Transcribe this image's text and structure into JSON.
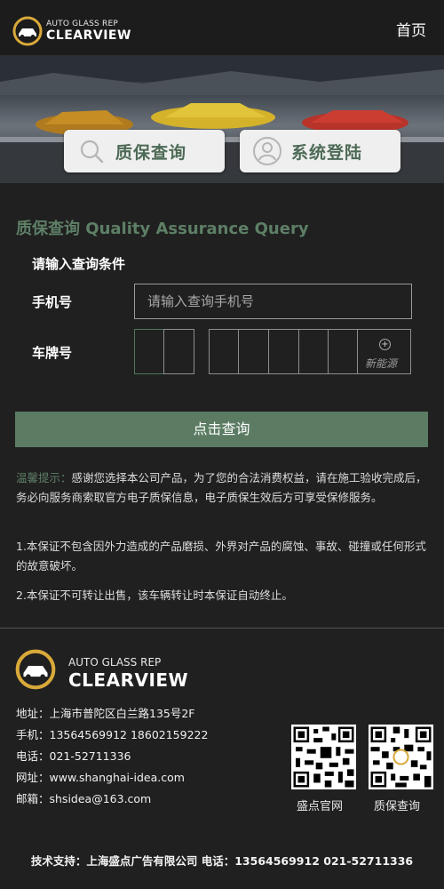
{
  "header": {
    "brand_small": "AUTO GLASS REP",
    "brand_big": "CLEARVIEW",
    "home_label": "首页"
  },
  "banner": {
    "query_label": "质保查询",
    "login_label": "系统登陆"
  },
  "form": {
    "section_title": "质保查询 Quality Assurance Query",
    "prompt": "请输入查询条件",
    "phone_label": "手机号",
    "phone_placeholder": "请输入查询手机号",
    "phone_value": "",
    "plate_label": "车牌号",
    "new_energy_label": "新能源",
    "submit_label": "点击查询"
  },
  "notice": {
    "tip_label": "温馨提示：",
    "tip_text": "感谢您选择本公司产品，为了您的合法消费权益，请在施工验收完成后，务必向服务商索取官方电子质保信息，电子质保生效后方可享受保修服务。",
    "item1": "1.本保证不包含因外力造成的产品磨损、外界对产品的腐蚀、事故、碰撞或任何形式的故意破坏。",
    "item2": "2.本保证不可转让出售，该车辆转让时本保证自动终止。"
  },
  "footer": {
    "brand_small": "AUTO GLASS REP",
    "brand_big": "CLEARVIEW",
    "address": "地址：上海市普陀区白兰路135号2F",
    "mobile": "手机：13564569912 18602159222",
    "phone": "电话：021-52711336",
    "website": "网址：www.shanghai-idea.com",
    "email": "邮箱：shsidea@163.com",
    "qr1_label": "盛点官网",
    "qr2_label": "质保查询",
    "tech_support": "技术支持：上海盛点广告有限公司  电话：13564569912  021-52711336"
  },
  "colors": {
    "accent": "#5b7c63",
    "title_green": "#5d7f66",
    "background": "#202020"
  },
  "icons": {
    "logo": "car-logo-icon",
    "query": "search-icon",
    "login": "user-icon",
    "new_energy": "plus-circle-icon"
  }
}
